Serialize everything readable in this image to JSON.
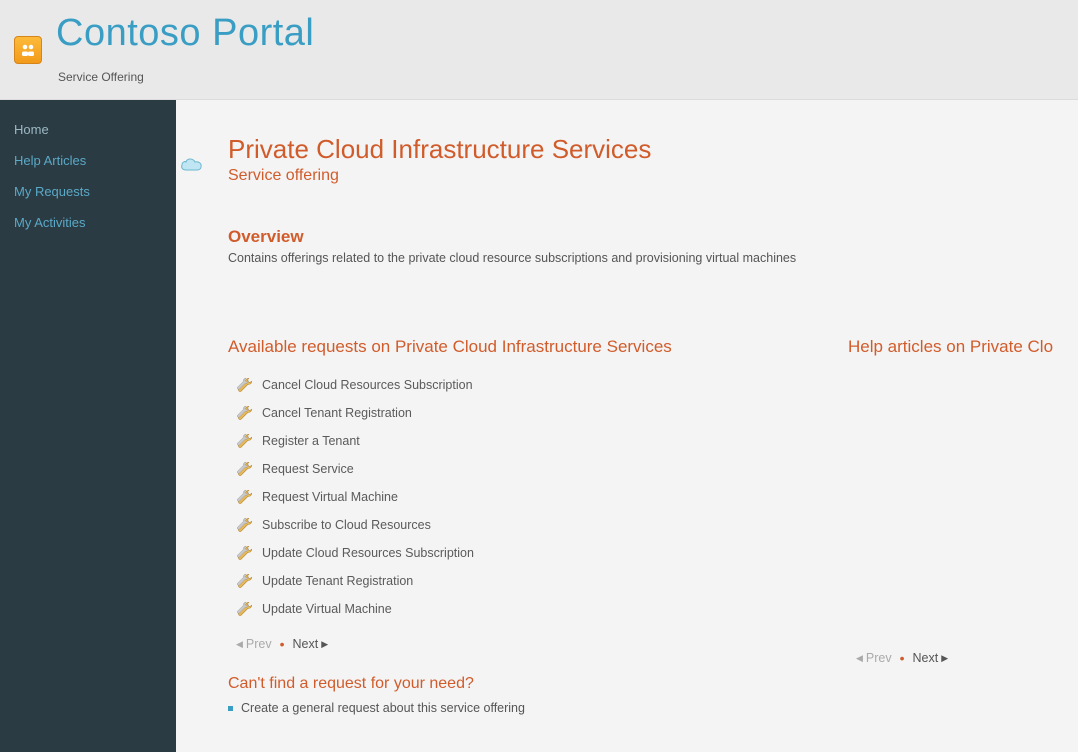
{
  "header": {
    "portal_title": "Contoso Portal",
    "subtitle": "Service Offering"
  },
  "sidebar": {
    "items": [
      {
        "label": "Home",
        "active": true
      },
      {
        "label": "Help Articles",
        "active": false
      },
      {
        "label": "My Requests",
        "active": false
      },
      {
        "label": "My Activities",
        "active": false
      }
    ]
  },
  "page": {
    "title": "Private Cloud Infrastructure Services",
    "subtitle": "Service offering",
    "overview_heading": "Overview",
    "overview_text": "Contains offerings related to the private cloud resource subscriptions and provisioning virtual machines"
  },
  "requests": {
    "heading": "Available requests on Private Cloud Infrastructure Services",
    "items": [
      "Cancel Cloud Resources Subscription",
      "Cancel Tenant Registration",
      "Register a Tenant",
      "Request Service",
      "Request Virtual Machine",
      "Subscribe to Cloud Resources",
      "Update Cloud Resources Subscription",
      "Update Tenant Registration",
      "Update Virtual Machine"
    ],
    "pager": {
      "prev": "Prev",
      "next": "Next"
    }
  },
  "help": {
    "heading": "Help articles on Private Clo",
    "pager": {
      "prev": "Prev",
      "next": "Next"
    }
  },
  "not_found": {
    "heading": "Can't find a request for your need?",
    "link": "Create a general request about this service offering"
  },
  "colors": {
    "accent": "#d15c2b",
    "link": "#3a9ec4",
    "sidebar_bg": "#2b3b44"
  }
}
